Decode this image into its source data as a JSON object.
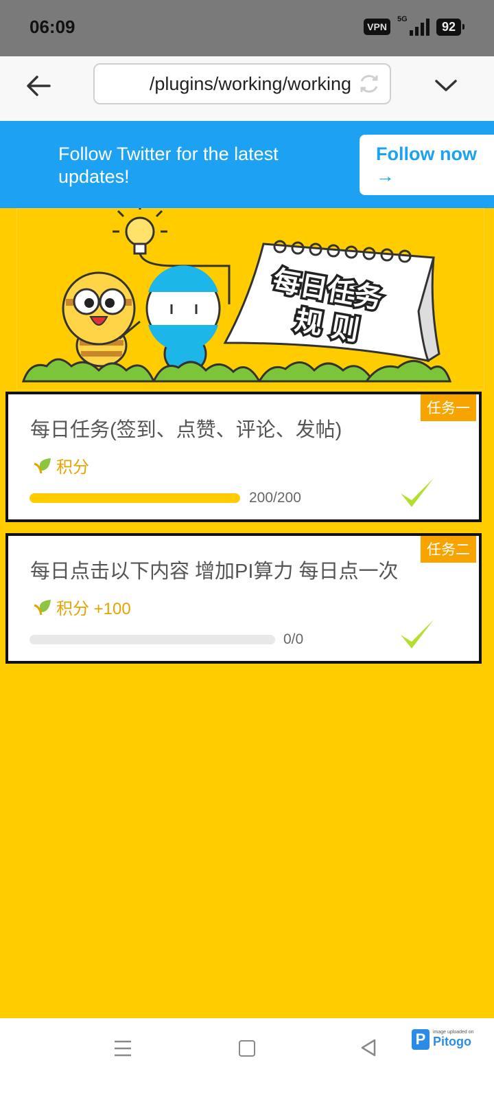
{
  "status_bar": {
    "time": "06:09",
    "vpn": "VPN",
    "network": "5G",
    "battery": "92"
  },
  "browser": {
    "url": "/plugins/working/working"
  },
  "banner": {
    "message": "Follow Twitter for the latest updates!",
    "button": "Follow now →"
  },
  "hero": {
    "sign_line1": "每日任务",
    "sign_line2": "规 则"
  },
  "tasks": [
    {
      "tag": "任务一",
      "title": "每日任务(签到、点赞、评论、发帖)",
      "reward": "积分",
      "progress_text": "200/200",
      "progress": 1.0,
      "completed": true
    },
    {
      "tag": "任务二",
      "title": "每日点击以下内容 增加PI算力 每日点一次",
      "reward": "积分 +100",
      "progress_text": "0/0",
      "progress": 0,
      "completed": true
    }
  ],
  "watermark": {
    "line1": "image uploaded on",
    "name": "Pitogo"
  },
  "colors": {
    "background": "#ffcc00",
    "banner": "#1da1f2",
    "tag": "#f7a400",
    "check": "#b3e02e"
  }
}
